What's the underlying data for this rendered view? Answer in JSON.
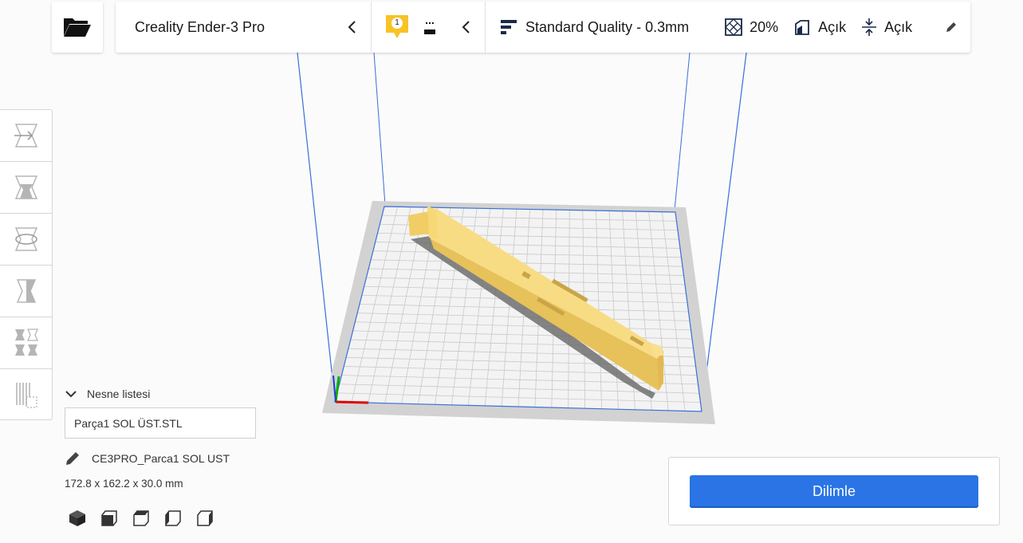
{
  "topbar": {
    "printer_name": "Creality Ender-3 Pro",
    "material_count": "1",
    "material_ext": "...",
    "quality": "Standard Quality - 0.3mm",
    "infill": "20%",
    "support": "Açık",
    "adhesion": "Açık"
  },
  "object_list": {
    "header": "Nesne listesi",
    "item": "Parça1 SOL ÜST.STL",
    "job_name": "CE3PRO_Parca1 SOL UST",
    "dimensions": "172.8 x 162.2 x 30.0 mm"
  },
  "slice": {
    "label": "Dilimle"
  },
  "colors": {
    "accent": "#2a74e6",
    "model": "#f5d774",
    "badge": "#f7c325",
    "build_volume": "#3a6fd8"
  },
  "icons": {
    "open": "folder-open-icon",
    "tools": [
      "move-tool-icon",
      "scale-tool-icon",
      "rotate-tool-icon",
      "mirror-tool-icon",
      "per-model-settings-icon",
      "support-blocker-icon"
    ],
    "views": [
      "3d-view-icon",
      "front-view-icon",
      "top-view-icon",
      "left-view-icon",
      "right-view-icon"
    ]
  }
}
